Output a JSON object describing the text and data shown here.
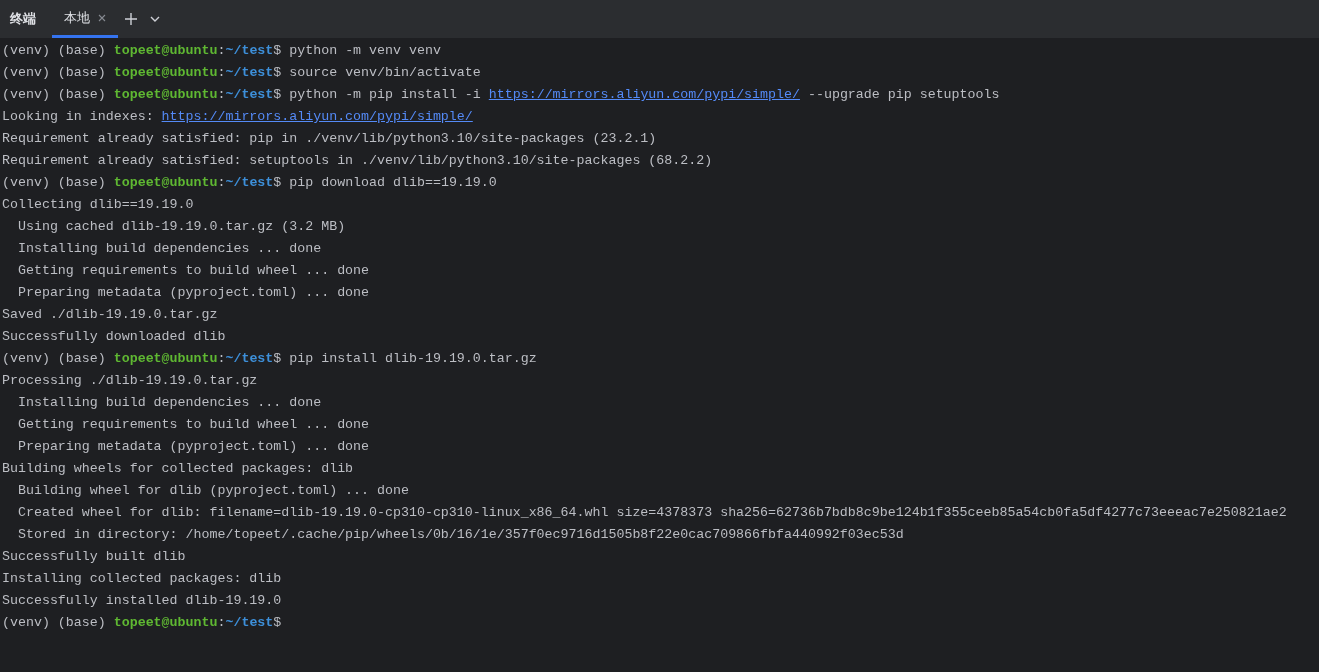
{
  "panel_title": "终端",
  "tabs": [
    {
      "label": "本地",
      "selected": true,
      "closable": true
    }
  ],
  "lines": [
    [
      {
        "kind": "plain",
        "text": "(venv) (base) "
      },
      {
        "kind": "user",
        "text": "topeet@ubuntu"
      },
      {
        "kind": "plain",
        "text": ":"
      },
      {
        "kind": "path",
        "text": "~/test"
      },
      {
        "kind": "plain",
        "text": "$ python -m venv venv"
      }
    ],
    [
      {
        "kind": "plain",
        "text": "(venv) (base) "
      },
      {
        "kind": "user",
        "text": "topeet@ubuntu"
      },
      {
        "kind": "plain",
        "text": ":"
      },
      {
        "kind": "path",
        "text": "~/test"
      },
      {
        "kind": "plain",
        "text": "$ source venv/bin/activate"
      }
    ],
    [
      {
        "kind": "plain",
        "text": "(venv) (base) "
      },
      {
        "kind": "user",
        "text": "topeet@ubuntu"
      },
      {
        "kind": "plain",
        "text": ":"
      },
      {
        "kind": "path",
        "text": "~/test"
      },
      {
        "kind": "plain",
        "text": "$ python -m pip install -i "
      },
      {
        "kind": "link",
        "text": "https://mirrors.aliyun.com/pypi/simple/"
      },
      {
        "kind": "plain",
        "text": " --upgrade pip setuptools"
      }
    ],
    [
      {
        "kind": "plain",
        "text": "Looking in indexes: "
      },
      {
        "kind": "link",
        "text": "https://mirrors.aliyun.com/pypi/simple/"
      }
    ],
    [
      {
        "kind": "plain",
        "text": "Requirement already satisfied: pip in ./venv/lib/python3.10/site-packages (23.2.1)"
      }
    ],
    [
      {
        "kind": "plain",
        "text": "Requirement already satisfied: setuptools in ./venv/lib/python3.10/site-packages (68.2.2)"
      }
    ],
    [
      {
        "kind": "plain",
        "text": "(venv) (base) "
      },
      {
        "kind": "user",
        "text": "topeet@ubuntu"
      },
      {
        "kind": "plain",
        "text": ":"
      },
      {
        "kind": "path",
        "text": "~/test"
      },
      {
        "kind": "plain",
        "text": "$ pip download dlib==19.19.0"
      }
    ],
    [
      {
        "kind": "plain",
        "text": "Collecting dlib==19.19.0"
      }
    ],
    [
      {
        "kind": "plain",
        "text": "  Using cached dlib-19.19.0.tar.gz (3.2 MB)"
      }
    ],
    [
      {
        "kind": "plain",
        "text": "  Installing build dependencies ... done"
      }
    ],
    [
      {
        "kind": "plain",
        "text": "  Getting requirements to build wheel ... done"
      }
    ],
    [
      {
        "kind": "plain",
        "text": "  Preparing metadata (pyproject.toml) ... done"
      }
    ],
    [
      {
        "kind": "plain",
        "text": "Saved ./dlib-19.19.0.tar.gz"
      }
    ],
    [
      {
        "kind": "plain",
        "text": "Successfully downloaded dlib"
      }
    ],
    [
      {
        "kind": "plain",
        "text": "(venv) (base) "
      },
      {
        "kind": "user",
        "text": "topeet@ubuntu"
      },
      {
        "kind": "plain",
        "text": ":"
      },
      {
        "kind": "path",
        "text": "~/test"
      },
      {
        "kind": "plain",
        "text": "$ pip install dlib-19.19.0.tar.gz"
      }
    ],
    [
      {
        "kind": "plain",
        "text": "Processing ./dlib-19.19.0.tar.gz"
      }
    ],
    [
      {
        "kind": "plain",
        "text": "  Installing build dependencies ... done"
      }
    ],
    [
      {
        "kind": "plain",
        "text": "  Getting requirements to build wheel ... done"
      }
    ],
    [
      {
        "kind": "plain",
        "text": "  Preparing metadata (pyproject.toml) ... done"
      }
    ],
    [
      {
        "kind": "plain",
        "text": "Building wheels for collected packages: dlib"
      }
    ],
    [
      {
        "kind": "plain",
        "text": "  Building wheel for dlib (pyproject.toml) ... done"
      }
    ],
    [
      {
        "kind": "plain",
        "text": "  Created wheel for dlib: filename=dlib-19.19.0-cp310-cp310-linux_x86_64.whl size=4378373 sha256=62736b7bdb8c9be124b1f355ceeb85a54cb0fa5df4277c73eeeac7e250821ae2"
      }
    ],
    [
      {
        "kind": "plain",
        "text": "  Stored in directory: /home/topeet/.cache/pip/wheels/0b/16/1e/357f0ec9716d1505b8f22e0cac709866fbfa440992f03ec53d"
      }
    ],
    [
      {
        "kind": "plain",
        "text": "Successfully built dlib"
      }
    ],
    [
      {
        "kind": "plain",
        "text": "Installing collected packages: dlib"
      }
    ],
    [
      {
        "kind": "plain",
        "text": "Successfully installed dlib-19.19.0"
      }
    ],
    [
      {
        "kind": "plain",
        "text": "(venv) (base) "
      },
      {
        "kind": "user",
        "text": "topeet@ubuntu"
      },
      {
        "kind": "plain",
        "text": ":"
      },
      {
        "kind": "path",
        "text": "~/test"
      },
      {
        "kind": "plain",
        "text": "$"
      }
    ]
  ]
}
